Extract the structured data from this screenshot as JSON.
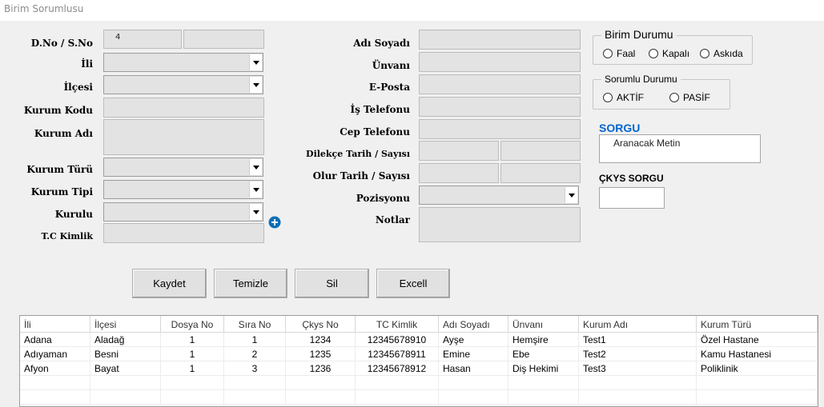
{
  "window": {
    "title": "Birim Sorumlusu"
  },
  "left_form": {
    "dno_label": "D.No / S.No",
    "dno_value": "4",
    "sno_value": "",
    "il_label": "İli",
    "ilce_label": "İlçesi",
    "kurum_kodu_label": "Kurum Kodu",
    "kurum_adi_label": "Kurum Adı",
    "kurum_turu_label": "Kurum Türü",
    "kurum_tipi_label": "Kurum Tipi",
    "kurulu_label": "Kurulu",
    "tc_label": "T.C Kimlik"
  },
  "middle_form": {
    "adi_soyadi_label": "Adı Soyadı",
    "unvani_label": "Ünvanı",
    "eposta_label": "E-Posta",
    "is_tel_label": "İş Telefonu",
    "cep_tel_label": "Cep Telefonu",
    "dilekce_label": "Dilekçe Tarih / Sayısı",
    "olur_label": "Olur Tarih / Sayısı",
    "pozisyon_label": "Pozisyonu",
    "notlar_label": "Notlar"
  },
  "birim_durumu": {
    "legend": "Birim Durumu",
    "options": [
      "Faal",
      "Kapalı",
      "Askıda"
    ]
  },
  "sorumlu_durumu": {
    "legend": "Sorumlu Durumu",
    "options": [
      "AKTİF",
      "PASİF"
    ]
  },
  "sorgu": {
    "title": "SORGU",
    "placeholder": "Aranacak Metin"
  },
  "ckys": {
    "title": "ÇKYS SORGU"
  },
  "buttons": {
    "kaydet": "Kaydet",
    "temizle": "Temizle",
    "sil": "Sil",
    "excell": "Excell"
  },
  "colors": {
    "accent": "#0066cc",
    "field_bg": "#e3e3e3"
  },
  "grid": {
    "columns": [
      "İli",
      "İlçesi",
      "Dosya No",
      "Sıra No",
      "Çkys No",
      "TC Kimlik",
      "Adı Soyadı",
      "Ünvanı",
      "Kurum Adı",
      "Kurum Türü"
    ],
    "rows": [
      [
        "Adana",
        "Aladağ",
        "1",
        "1",
        "1234",
        "12345678910",
        "Ayşe",
        "Hemşire",
        "Test1",
        "Özel Hastane"
      ],
      [
        "Adıyaman",
        "Besni",
        "1",
        "2",
        "1235",
        "12345678911",
        "Emine",
        "Ebe",
        "Test2",
        "Kamu Hastanesi"
      ],
      [
        "Afyon",
        "Bayat",
        "1",
        "3",
        "1236",
        "12345678912",
        "Hasan",
        "Diş Hekimi",
        "Test3",
        "Poliklinik"
      ]
    ]
  }
}
